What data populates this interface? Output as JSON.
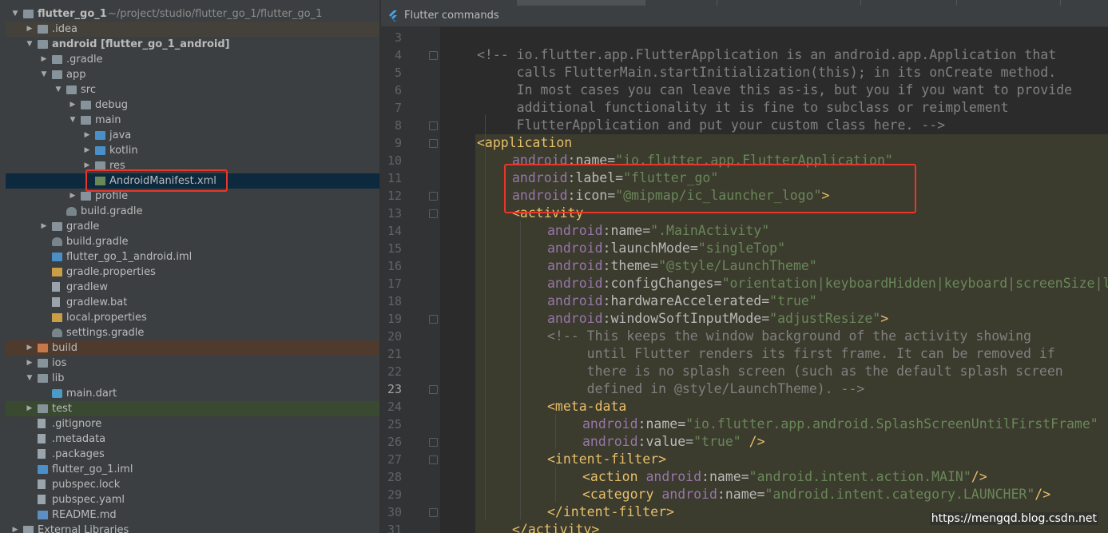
{
  "project_tree": {
    "root": {
      "name": "flutter_go_1",
      "path": "~/project/studio/flutter_go_1/flutter_go_1"
    },
    "rows": [
      {
        "label": "flutter_go_1",
        "extra": "~/project/studio/flutter_go_1/flutter_go_1",
        "icon": "folder-icon"
      },
      {
        "label": ".idea",
        "icon": "folder-icon"
      },
      {
        "label": "android [flutter_go_1_android]",
        "icon": "folder-icon"
      },
      {
        "label": ".gradle",
        "icon": "folder-icon"
      },
      {
        "label": "app",
        "icon": "folder-icon"
      },
      {
        "label": "src",
        "icon": "folder-icon"
      },
      {
        "label": "debug",
        "icon": "folder-icon"
      },
      {
        "label": "main",
        "icon": "folder-icon"
      },
      {
        "label": "java",
        "icon": "folder-icon"
      },
      {
        "label": "kotlin",
        "icon": "folder-icon"
      },
      {
        "label": "res",
        "icon": "folder-icon"
      },
      {
        "label": "AndroidManifest.xml",
        "icon": "xml-file-icon"
      },
      {
        "label": "profile",
        "icon": "folder-icon"
      },
      {
        "label": "build.gradle",
        "icon": "gradle-file-icon"
      },
      {
        "label": "gradle",
        "icon": "folder-icon"
      },
      {
        "label": "build.gradle",
        "icon": "gradle-file-icon"
      },
      {
        "label": "flutter_go_1_android.iml",
        "icon": "module-file-icon"
      },
      {
        "label": "gradle.properties",
        "icon": "properties-file-icon"
      },
      {
        "label": "gradlew",
        "icon": "file-icon"
      },
      {
        "label": "gradlew.bat",
        "icon": "file-icon"
      },
      {
        "label": "local.properties",
        "icon": "properties-file-icon"
      },
      {
        "label": "settings.gradle",
        "icon": "gradle-file-icon"
      },
      {
        "label": "build",
        "icon": "folder-icon"
      },
      {
        "label": "ios",
        "icon": "folder-icon"
      },
      {
        "label": "lib",
        "icon": "folder-icon"
      },
      {
        "label": "main.dart",
        "icon": "dart-file-icon"
      },
      {
        "label": "test",
        "icon": "folder-icon"
      },
      {
        "label": ".gitignore",
        "icon": "file-icon"
      },
      {
        "label": ".metadata",
        "icon": "file-icon"
      },
      {
        "label": ".packages",
        "icon": "file-icon"
      },
      {
        "label": "flutter_go_1.iml",
        "icon": "module-file-icon"
      },
      {
        "label": "pubspec.lock",
        "icon": "file-icon"
      },
      {
        "label": "pubspec.yaml",
        "icon": "yaml-file-icon"
      },
      {
        "label": "README.md",
        "icon": "markdown-file-icon"
      },
      {
        "label": "External Libraries",
        "icon": "library-icon"
      }
    ]
  },
  "editor": {
    "bar_label": "Flutter commands",
    "current_line": "23",
    "line_numbers": [
      "3",
      "4",
      "5",
      "6",
      "7",
      "8",
      "9",
      "10",
      "11",
      "12",
      "13",
      "14",
      "15",
      "16",
      "17",
      "18",
      "19",
      "20",
      "21",
      "22",
      "23",
      "24",
      "25",
      "26",
      "27",
      "28",
      "29",
      "30",
      "31"
    ],
    "lines": {
      "l4": "<!-- io.flutter.app.FlutterApplication is an android.app.Application that",
      "l5": "     calls FlutterMain.startInitialization(this); in its onCreate method.",
      "l6": "     In most cases you can leave this as-is, but you if you want to provide",
      "l7": "     additional functionality it is fine to subclass or reimplement",
      "l8": "     FlutterApplication and put your custom class here. -->",
      "l9_tag": "<application",
      "l10_ns": "android",
      "l10_attr": ":name=",
      "l10_val": "\"io.flutter.app.FlutterApplication\"",
      "l11_ns": "android",
      "l11_attr": ":label=",
      "l11_val": "\"flutter_go\"",
      "l12_ns": "android",
      "l12_attr": ":icon=",
      "l12_val": "\"@mipmap/ic_launcher_logo\"",
      "l12_end": ">",
      "l13_tag": "<activity",
      "l14_ns": "android",
      "l14_attr": ":name=",
      "l14_val": "\".MainActivity\"",
      "l15_ns": "android",
      "l15_attr": ":launchMode=",
      "l15_val": "\"singleTop\"",
      "l16_ns": "android",
      "l16_attr": ":theme=",
      "l16_val": "\"@style/LaunchTheme\"",
      "l17_ns": "android",
      "l17_attr": ":configChanges=",
      "l17_val": "\"orientation|keyboardHidden|keyboard|screenSize|locale|layoutDirection\"",
      "l18_ns": "android",
      "l18_attr": ":hardwareAccelerated=",
      "l18_val": "\"true\"",
      "l19_ns": "android",
      "l19_attr": ":windowSoftInputMode=",
      "l19_val": "\"adjustResize\"",
      "l19_end": ">",
      "l20": "<!-- This keeps the window background of the activity showing",
      "l21": "     until Flutter renders its first frame. It can be removed if",
      "l22": "     there is no splash screen (such as the default splash screen",
      "l23": "     defined in @style/LaunchTheme). -->",
      "l24_tag": "<meta-data",
      "l25_ns": "android",
      "l25_attr": ":name=",
      "l25_val": "\"io.flutter.app.android.SplashScreenUntilFirstFrame\"",
      "l26_ns": "android",
      "l26_attr": ":value=",
      "l26_val": "\"true\"",
      "l26_end": " />",
      "l27_tag": "<intent-filter>",
      "l28_tag": "<action ",
      "l28_ns": "android",
      "l28_attr": ":name=",
      "l28_val": "\"android.intent.action.MAIN\"",
      "l28_end": "/>",
      "l29_tag": "<category ",
      "l29_ns": "android",
      "l29_attr": ":name=",
      "l29_val": "\"android.intent.category.LAUNCHER\"",
      "l29_end": "/>",
      "l30_tag": "</intent-filter>",
      "l31_tag": "</activity>"
    }
  },
  "watermark": "https://mengqd.blog.csdn.net",
  "colors": {
    "panel_bg": "#3c3f41",
    "editor_bg": "#2b2b2b",
    "highlight_bg": "#3b3b2e",
    "selection": "#0d293e",
    "annotation_red": "#e8372a",
    "xml_tag": "#e8bf6a",
    "xml_namespace": "#9876aa",
    "xml_value": "#6a8759",
    "comment": "#808080"
  }
}
